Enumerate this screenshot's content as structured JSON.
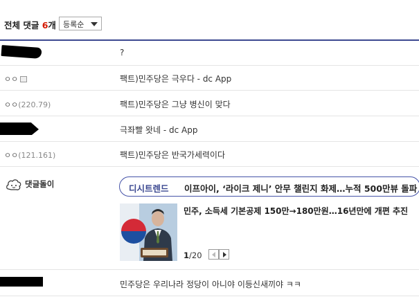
{
  "header": {
    "title_prefix": "전체 댓글 ",
    "count": "6",
    "title_suffix": "개",
    "sort_selected": "등록순"
  },
  "comments": [
    {
      "nick": "",
      "ip": "",
      "text": "?"
    },
    {
      "nick": "ㅇㅇ",
      "ip": "",
      "text": "팩트)민주당은 극우다 - dc App"
    },
    {
      "nick": "ㅇㅇ",
      "ip": "(220.79)",
      "text": "팩트)민주당은 그냥 병신이 맞다"
    },
    {
      "nick": "",
      "ip": "",
      "text": "극좌빨 왓네 - dc App"
    },
    {
      "nick": "ㅇㅇ",
      "ip": "(121.161)",
      "text": "팩트)민주당은 반국가세력이다"
    },
    {
      "nick": "",
      "ip": "",
      "text": "민주당은 우리나라 정당이 아니야 이등신새끼야 ㅋㅋ"
    }
  ],
  "bot": {
    "label": "댓글돌이",
    "trend_brand": "디시트렌드",
    "trend_headline": "이프아이, ‘라이크 제니’ 안무 챌린지 화제…누적 500만뷰 돌파",
    "news_title": "민주, 소득세 기본공제 150만→180만원…16년만에 개편 추진",
    "page_current": "1",
    "page_total": "/20"
  },
  "colors": {
    "accent": "#3b4890",
    "count_red": "#d31900"
  }
}
